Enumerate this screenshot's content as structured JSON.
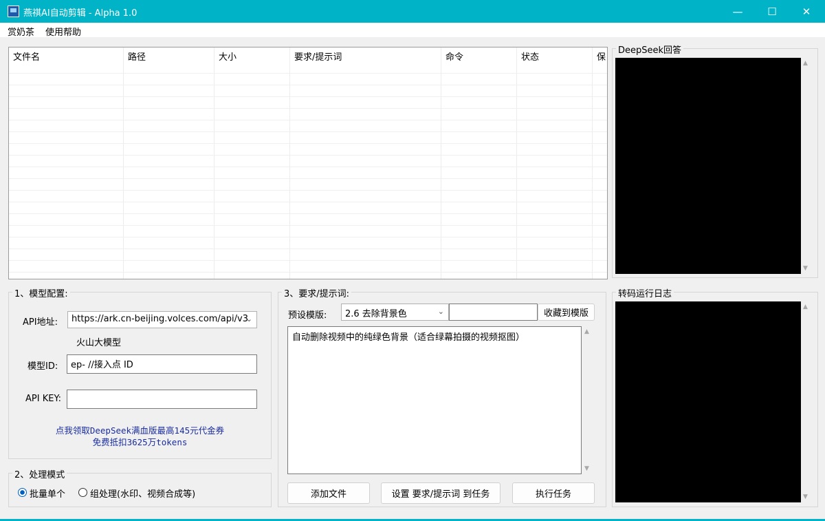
{
  "window": {
    "title": "燕祺AI自动剪辑 - Alpha 1.0",
    "controls": {
      "minimize": "—",
      "maximize": "☐",
      "close": "✕"
    }
  },
  "menu": [
    "赏奶茶",
    "使用帮助"
  ],
  "file_table": {
    "columns": [
      "文件名",
      "路径",
      "大小",
      "要求/提示词",
      "命令",
      "状态",
      "保"
    ],
    "rows": []
  },
  "deepseek_panel": {
    "title": "DeepSeek回答"
  },
  "model_config": {
    "title": "1、模型配置:",
    "api_label": "API地址:",
    "api_value": "https://ark.cn-beijing.volces.com/api/v3",
    "provider": "火山大模型",
    "model_id_label": "模型ID:",
    "model_id_value": "ep- //接入点 ID",
    "api_key_label": "API KEY:",
    "api_key_value": "",
    "promo_line1": "点我领取DeepSeek满血版最高145元代金券",
    "promo_line2": "免费抵扣3625万tokens"
  },
  "process_mode": {
    "title": "2、处理模式",
    "options": [
      "批量单个",
      "组处理(水印、视频合成等)"
    ],
    "selected": "批量单个"
  },
  "prompt_panel": {
    "title": "3、要求/提示词:",
    "preset_label": "预设模版:",
    "preset_value": "2.6  去除背景色",
    "preset_name_value": "",
    "save_template": "收藏到模版",
    "prompt_text": "自动删除视频中的纯绿色背景（适合绿幕拍摄的视频抠图）",
    "add_file": "添加文件",
    "set_prompt": "设置 要求/提示词 到任务",
    "run_task": "执行任务"
  },
  "log_panel": {
    "title": "转码运行日志"
  },
  "icons": {
    "scroll_up": "▲",
    "scroll_down": "▼",
    "dropdown": "⌄"
  },
  "colors": {
    "titlebar": "#00b3c7",
    "promo_link": "#1a2da0",
    "radio_selected": "#0060c0"
  }
}
